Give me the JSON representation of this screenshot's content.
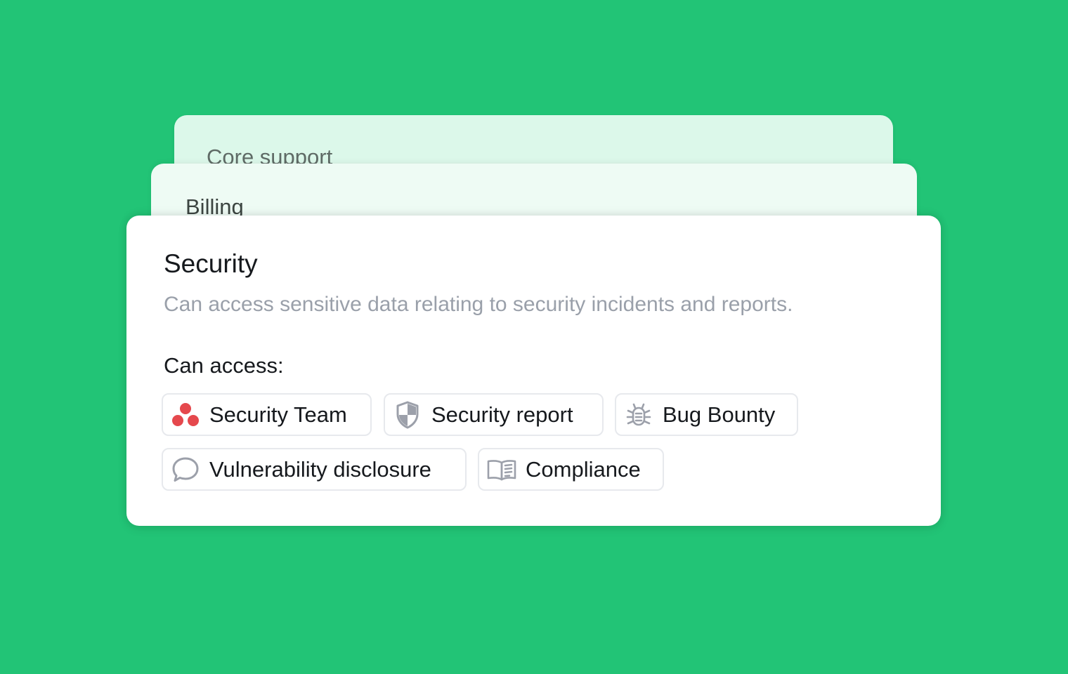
{
  "background_color": "#22c476",
  "cards": {
    "back": {
      "title": "Core support"
    },
    "middle": {
      "title": "Billing"
    },
    "front": {
      "title": "Security",
      "description": "Can access sensitive data relating to security incidents and reports.",
      "access_heading": "Can access:"
    }
  },
  "access_items": [
    {
      "label": "Security Team",
      "icon": "asana-team-icon",
      "icon_color": "#e5484d"
    },
    {
      "label": "Security report",
      "icon": "shield-icon",
      "icon_color": "#9ca0aa"
    },
    {
      "label": "Bug Bounty",
      "icon": "bug-icon",
      "icon_color": "#9ca0aa"
    },
    {
      "label": "Vulnerability disclosure",
      "icon": "speech-bubble-icon",
      "icon_color": "#9ca0aa"
    },
    {
      "label": "Compliance",
      "icon": "open-book-icon",
      "icon_color": "#9ca0aa"
    }
  ]
}
